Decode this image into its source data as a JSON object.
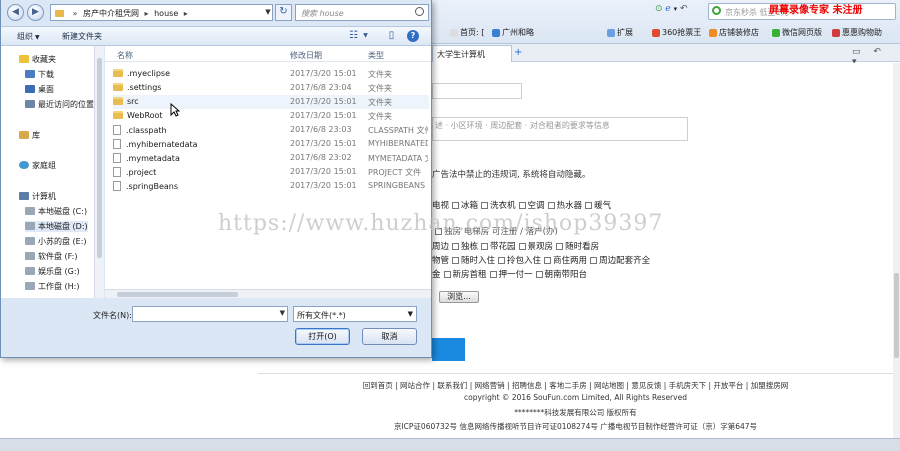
{
  "browser": {
    "search_placeholder": "京东秒杀 低至1元",
    "watermark_registration": "屏幕录像专家 未注册",
    "bookmarks": [
      {
        "label": "首页: ["
      },
      {
        "label": "广州和略"
      },
      {
        "label": "扩展"
      },
      {
        "label": "360抢票王"
      },
      {
        "label": "店铺装修店"
      },
      {
        "label": "微信网页版"
      },
      {
        "label": "惠惠购物助"
      }
    ],
    "active_tab": "大学生计算机",
    "new_tab": "+",
    "tab_controls": "▭ ↶ ▾"
  },
  "page": {
    "hint_text": "述 · 小区环境 · 周边配套 · 对合租者的要求等信息",
    "warning_text": "广告法中禁止的违规词, 系统将自动隐藏。",
    "facilities_row1": [
      "电视",
      "冰箱",
      "洗衣机",
      "空调",
      "热水器",
      "暖气"
    ],
    "facilities_row2_text": "独房  电梯房  可注册 / 落户(办)",
    "tags_row1": [
      "周边",
      "独栋",
      "带花园",
      "景观房",
      "随时看房"
    ],
    "tags_row2": [
      "物管",
      "随时入住",
      "拎包入住",
      "商住两用",
      "周边配套齐全"
    ],
    "tags_row3": [
      "金",
      "新房首租",
      "押一付一",
      "朝南带阳台"
    ],
    "browse_label": "浏览...",
    "footer_links": "回到首页 | 网站合作 | 联系我们 | 网络营销 | 招聘信息 | 客地二手房 | 网站地图 | 意见反馈 | 手机房天下 | 开放平台 | 加盟搜房网",
    "footer_copyright": "copyright © 2016 SouFun.com Limited, All Rights Reserved",
    "footer_company": "********科技发展有限公司 版权所有",
    "footer_license": "京ICP证060732号  信息网络传播视听节目许可证0108274号  广播电视节目制作经营许可证（京）字第647号",
    "watermark_url": "https://www.huzhan.com/ishop39397"
  },
  "dialog": {
    "path": [
      "房产中介租凭网",
      "house"
    ],
    "search_placeholder": "搜索 house",
    "toolbar": {
      "organize": "组织",
      "new_folder": "新建文件夹"
    },
    "nav": [
      {
        "label": "收藏夹",
        "icon": "star-icon",
        "level": 0
      },
      {
        "label": "下载",
        "icon": "download-folder-icon",
        "level": 1
      },
      {
        "label": "桌面",
        "icon": "desktop-icon",
        "level": 1
      },
      {
        "label": "最近访问的位置",
        "icon": "recent-icon",
        "level": 1
      },
      {
        "label": "库",
        "icon": "library-icon",
        "level": 0
      },
      {
        "label": "家庭组",
        "icon": "homegroup-icon",
        "level": 0
      },
      {
        "label": "计算机",
        "icon": "computer-icon",
        "level": 0
      },
      {
        "label": "本地磁盘 (C:)",
        "icon": "drive-icon",
        "level": 1
      },
      {
        "label": "本地磁盘 (D:)",
        "icon": "drive-icon",
        "level": 1
      },
      {
        "label": "小苏的盘 (E:)",
        "icon": "drive-icon",
        "level": 1
      },
      {
        "label": "软件盘 (F:)",
        "icon": "drive-icon",
        "level": 1
      },
      {
        "label": "娱乐盘 (G:)",
        "icon": "drive-icon",
        "level": 1
      },
      {
        "label": "工作盘 (H:)",
        "icon": "drive-icon",
        "level": 1
      }
    ],
    "columns": {
      "name": "名称",
      "date": "修改日期",
      "type": "类型"
    },
    "files": [
      {
        "name": ".myeclipse",
        "date": "2017/3/20 15:01",
        "type": "文件夹",
        "kind": "folder"
      },
      {
        "name": ".settings",
        "date": "2017/6/8 23:04",
        "type": "文件夹",
        "kind": "folder"
      },
      {
        "name": "src",
        "date": "2017/3/20 15:01",
        "type": "文件夹",
        "kind": "folder"
      },
      {
        "name": "WebRoot",
        "date": "2017/3/20 15:01",
        "type": "文件夹",
        "kind": "folder"
      },
      {
        "name": ".classpath",
        "date": "2017/6/8 23:03",
        "type": "CLASSPATH 文件",
        "kind": "file"
      },
      {
        "name": ".myhibernatedata",
        "date": "2017/3/20 15:01",
        "type": "MYHIBERNATED",
        "kind": "file"
      },
      {
        "name": ".mymetadata",
        "date": "2017/6/8 23:02",
        "type": "MYMETADATA 文",
        "kind": "file"
      },
      {
        "name": ".project",
        "date": "2017/3/20 15:01",
        "type": "PROJECT 文件",
        "kind": "file"
      },
      {
        "name": ".springBeans",
        "date": "2017/3/20 15:01",
        "type": "SPRINGBEANS",
        "kind": "file"
      }
    ],
    "filename_label": "文件名(N):",
    "filename_value": "",
    "filetype_value": "所有文件(*.*)",
    "open_label": "打开(O)",
    "cancel_label": "取消"
  }
}
